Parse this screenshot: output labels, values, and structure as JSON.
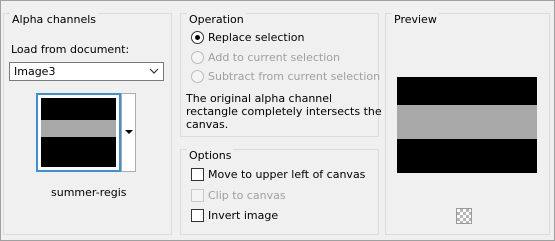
{
  "alpha": {
    "title": "Alpha channels",
    "load_label": "Load from document:",
    "document_value": "Image3",
    "thumbnail_label": "summer-regis"
  },
  "operation": {
    "title": "Operation",
    "options": [
      {
        "label": "Replace selection",
        "selected": true,
        "enabled": true
      },
      {
        "label": "Add to current selection",
        "selected": false,
        "enabled": false
      },
      {
        "label": "Subtract from current selection",
        "selected": false,
        "enabled": false
      }
    ],
    "message_line1": "The original alpha channel",
    "message_line2": "rectangle completely intersects the",
    "message_line3": "canvas."
  },
  "options": {
    "title": "Options",
    "items": [
      {
        "label": "Move to upper left of canvas",
        "checked": false,
        "enabled": true
      },
      {
        "label": "Clip to canvas",
        "checked": false,
        "enabled": false
      },
      {
        "label": "Invert image",
        "checked": false,
        "enabled": true
      }
    ]
  },
  "preview": {
    "title": "Preview"
  },
  "colors": {
    "selection_border": "#3c8ee0",
    "image_black": "#000000",
    "image_band": "#a8a8a8"
  }
}
